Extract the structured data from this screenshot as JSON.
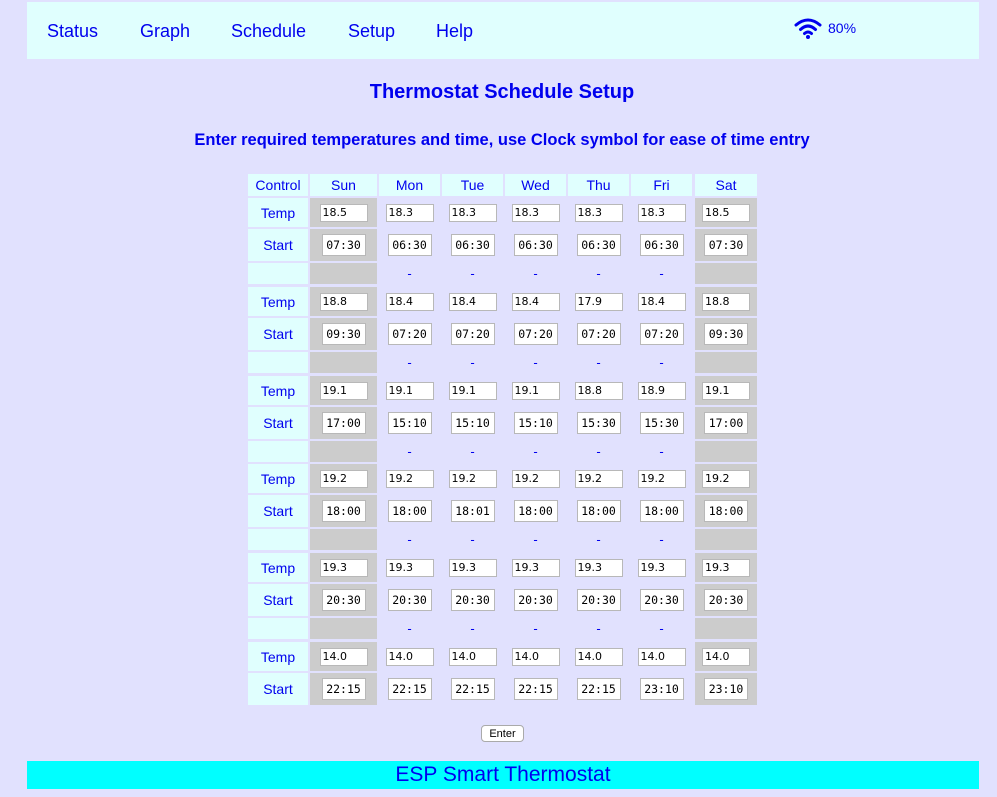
{
  "nav": {
    "items": [
      "Status",
      "Graph",
      "Schedule",
      "Setup",
      "Help"
    ],
    "wifi_icon": "wifi-icon",
    "signal": "80%"
  },
  "page": {
    "title": "Thermostat Schedule Setup",
    "subtitle": "Enter required temperatures and time, use Clock symbol for ease of time entry"
  },
  "schedule": {
    "control_header": "Control",
    "days": [
      "Sun",
      "Mon",
      "Tue",
      "Wed",
      "Thu",
      "Fri",
      "Sat"
    ],
    "temp_label": "Temp",
    "start_label": "Start",
    "separator": "-",
    "periods": [
      {
        "temps": [
          "18.5",
          "18.3",
          "18.3",
          "18.3",
          "18.3",
          "18.3",
          "18.5"
        ],
        "starts": [
          "07:30",
          "06:30",
          "06:30",
          "06:30",
          "06:30",
          "06:30",
          "07:30"
        ]
      },
      {
        "temps": [
          "18.8",
          "18.4",
          "18.4",
          "18.4",
          "17.9",
          "18.4",
          "18.8"
        ],
        "starts": [
          "09:30",
          "07:20",
          "07:20",
          "07:20",
          "07:20",
          "07:20",
          "09:30"
        ]
      },
      {
        "temps": [
          "19.1",
          "19.1",
          "19.1",
          "19.1",
          "18.8",
          "18.9",
          "19.1"
        ],
        "starts": [
          "17:00",
          "15:10",
          "15:10",
          "15:10",
          "15:30",
          "15:30",
          "17:00"
        ]
      },
      {
        "temps": [
          "19.2",
          "19.2",
          "19.2",
          "19.2",
          "19.2",
          "19.2",
          "19.2"
        ],
        "starts": [
          "18:00",
          "18:00",
          "18:01",
          "18:00",
          "18:00",
          "18:00",
          "18:00"
        ]
      },
      {
        "temps": [
          "19.3",
          "19.3",
          "19.3",
          "19.3",
          "19.3",
          "19.3",
          "19.3"
        ],
        "starts": [
          "20:30",
          "20:30",
          "20:30",
          "20:30",
          "20:30",
          "20:30",
          "20:30"
        ]
      },
      {
        "temps": [
          "14.0",
          "14.0",
          "14.0",
          "14.0",
          "14.0",
          "14.0",
          "14.0"
        ],
        "starts": [
          "22:15",
          "22:15",
          "22:15",
          "22:15",
          "22:15",
          "23:10",
          "23:10"
        ]
      }
    ]
  },
  "actions": {
    "enter_label": "Enter"
  },
  "footer": {
    "text": "ESP Smart Thermostat"
  },
  "colors": {
    "background": "#e1e1fe",
    "nav_background": "#e0fffe",
    "text_blue": "#0000ee",
    "weekend_cell": "#cccccc",
    "footer_background": "#00ffff"
  }
}
